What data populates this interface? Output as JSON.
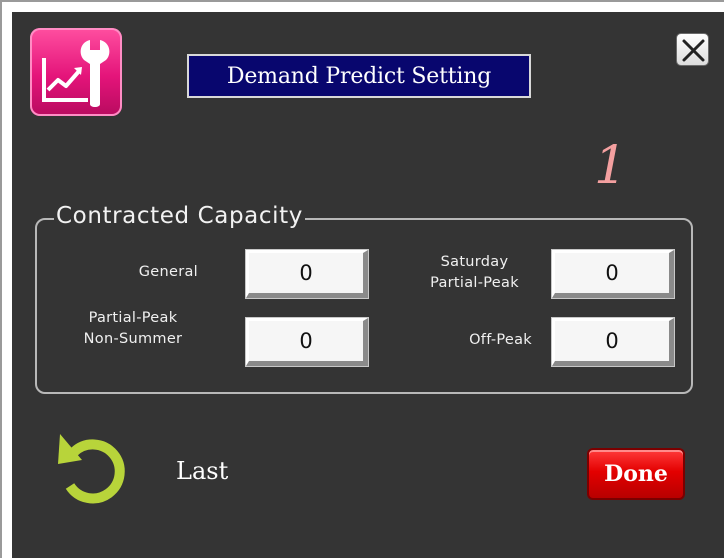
{
  "window": {
    "title": "Demand Predict Setting",
    "page_number": "1",
    "icon": "chart-wrench-icon"
  },
  "close_button": {
    "icon": "close-icon"
  },
  "contracted_capacity": {
    "title": "Contracted Capacity",
    "fields": [
      {
        "label_line1": "General",
        "label_line2": "",
        "value": "0"
      },
      {
        "label_line1": "Saturday",
        "label_line2": "Partial-Peak",
        "value": "0"
      },
      {
        "label_line1": "Partial-Peak",
        "label_line2": "Non-Summer",
        "value": "0"
      },
      {
        "label_line1": "Off-Peak",
        "label_line2": "",
        "value": "0"
      }
    ]
  },
  "footer": {
    "undo_icon": "undo-arrow-icon",
    "last_label": "Last",
    "done_label": "Done"
  },
  "colors": {
    "background": "#343434",
    "title_bar": "#08066e",
    "icon_pink": "#e4147a",
    "page_number": "#f4a0a0",
    "undo_green": "#b8d43a",
    "done_red": "#e30000"
  }
}
